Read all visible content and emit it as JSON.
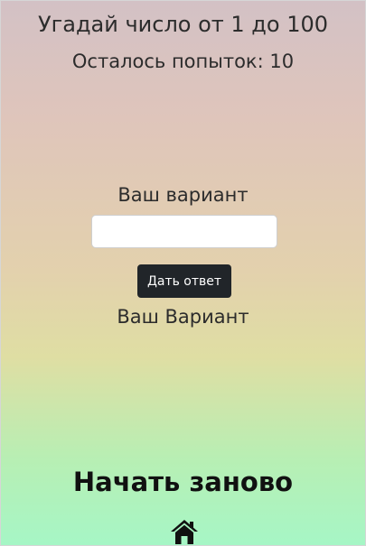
{
  "game": {
    "title": "Угадай число от 1 до 100",
    "attempts_text": "Осталось попыток: 10"
  },
  "form": {
    "label": "Ваш вариант",
    "input_value": "",
    "input_placeholder": "",
    "submit_label": "Дать ответ"
  },
  "result": {
    "text": "Ваш Вариант"
  },
  "footer": {
    "restart_label": "Начать заново",
    "home_icon": "home-icon"
  },
  "colors": {
    "button_bg": "#212529",
    "gradient_top": "#d3c1c5",
    "gradient_middle": "#e3d1ad",
    "gradient_bottom": "#a6f6c6"
  }
}
